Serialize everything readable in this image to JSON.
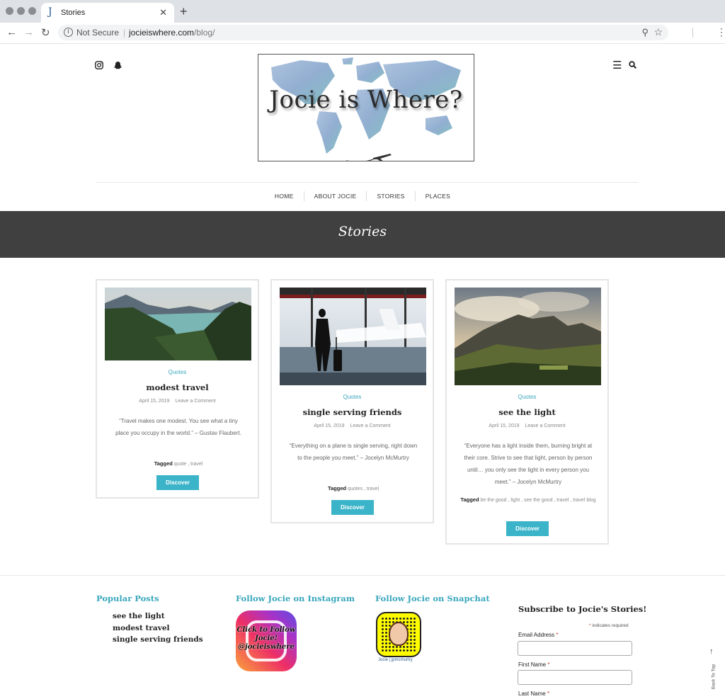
{
  "browser": {
    "tab_title": "Stories",
    "tab_favicon": "J",
    "tab_close": "✕",
    "new_tab": "+",
    "security_label": "Not Secure",
    "url_domain": "jocieiswhere.com",
    "url_path": "/blog/",
    "icons": [
      "back-arrow-icon",
      "forward-arrow-icon",
      "reload-icon",
      "info-icon",
      "zoom-icon",
      "star-icon",
      "menu-icon"
    ]
  },
  "header": {
    "logo_text": "Jocie is Where?",
    "social_icons": [
      "instagram-icon",
      "snapchat-icon"
    ],
    "tool_icons": [
      "hamburger-icon",
      "search-icon"
    ]
  },
  "nav": {
    "items": [
      "HOME",
      "ABOUT JOCIE",
      "STORIES",
      "PLACES"
    ]
  },
  "banner": {
    "title": "Stories"
  },
  "posts": [
    {
      "category": "Quotes",
      "title": "modest travel",
      "date": "April 15, 2019",
      "comment_link": "Leave a Comment",
      "excerpt": "“Travel makes one modest. You see what a tiny place you occupy in the world.” – Gustav Flaubert.",
      "tagged_label": "Tagged",
      "tags": "quote , travel",
      "button": "Discover"
    },
    {
      "category": "Quotes",
      "title": "single serving friends",
      "date": "April 15, 2019",
      "comment_link": "Leave a Comment",
      "excerpt": "“Everything on a plane is single serving, right down to the people you meet.” – Jocelyn McMurtry",
      "tagged_label": "Tagged",
      "tags": "quotes , travel",
      "button": "Discover"
    },
    {
      "category": "Quotes",
      "title": "see the light",
      "date": "April 15, 2019",
      "comment_link": "Leave a Comment",
      "excerpt": "“Everyone has a light inside them, burning bright at their core. Strive to see that light, person by person until… you only see the light in every person you meet.” – Jocelyn McMurtry",
      "tagged_label": "Tagged",
      "tags": "be the good , light , see the good , travel , travel blog",
      "button": "Discover"
    }
  ],
  "footer": {
    "popular_title": "Popular Posts",
    "popular_posts": [
      "see the light",
      "modest travel",
      "single serving friends"
    ],
    "instagram_title": "Follow Jocie on Instagram",
    "instagram_badge_text": "Click to Follow Jocie! @jocieiswhere",
    "snapchat_title": "Follow Jocie on Snapchat",
    "snapchat_caption": "Jocie | jpmcmurtry",
    "subscribe_title": "Subscribe to Jocie's Stories!",
    "required_note": "indicates required",
    "required_mark": "*",
    "fields": [
      "Email Address",
      "First Name",
      "Last Name"
    ],
    "back_to_top": "Back To Top",
    "back_to_top_arrow": "↑"
  },
  "colors": {
    "accent": "#3bb4c9",
    "banner_bg": "#404040"
  }
}
